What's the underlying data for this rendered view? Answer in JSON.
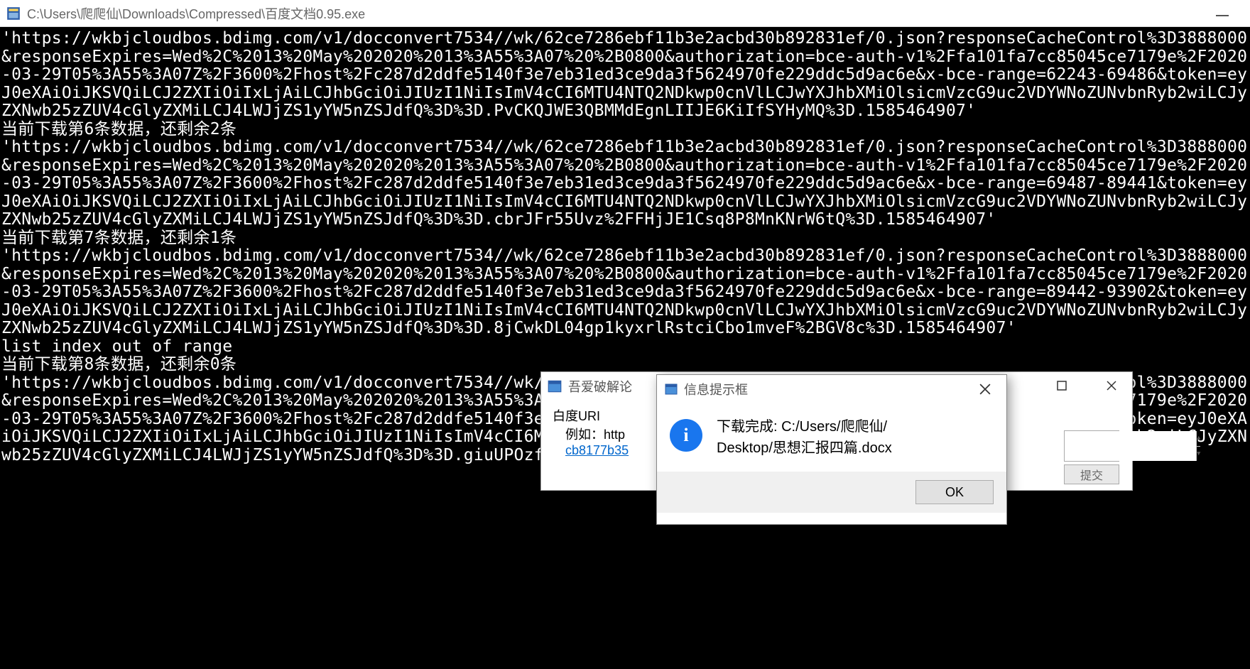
{
  "main_window": {
    "title": "C:\\Users\\爬爬仙\\Downloads\\Compressed\\百度文档0.95.exe"
  },
  "console_text": "'https://wkbjcloudbos.bdimg.com/v1/docconvert7534//wk/62ce7286ebf11b3e2acbd30b892831ef/0.json?responseCacheControl%3D3888000&responseExpires=Wed%2C%2013%20May%202020%2013%3A55%3A07%20%2B0800&authorization=bce-auth-v1%2Ffa101fa7cc85045ce7179e%2F2020-03-29T05%3A55%3A07Z%2F3600%2Fhost%2Fc287d2ddfe5140f3e7eb31ed3ce9da3f5624970fe229ddc5d9ac6e&x-bce-range=62243-69486&token=eyJ0eXAiOiJKSVQiLCJ2ZXIiOiIxLjAiLCJhbGciOiJIUzI1NiIsImV4cCI6MTU4NTQ2NDkwp0cnVlLCJwYXJhbXMiOlsicmVzcG9uc2VDYWNoZUNvbnRyb2wiLCJyZXNwb25zZUV4cGlyZXMiLCJ4LWJjZS1yYW5nZSJdfQ%3D%3D.PvCKQJWE3QBMMdEgnLIIJE6KiIfSYHyMQ%3D.1585464907'\n当前下载第6条数据，还剩余2条\n'https://wkbjcloudbos.bdimg.com/v1/docconvert7534//wk/62ce7286ebf11b3e2acbd30b892831ef/0.json?responseCacheControl%3D3888000&responseExpires=Wed%2C%2013%20May%202020%2013%3A55%3A07%20%2B0800&authorization=bce-auth-v1%2Ffa101fa7cc85045ce7179e%2F2020-03-29T05%3A55%3A07Z%2F3600%2Fhost%2Fc287d2ddfe5140f3e7eb31ed3ce9da3f5624970fe229ddc5d9ac6e&x-bce-range=69487-89441&token=eyJ0eXAiOiJKSVQiLCJ2ZXIiOiIxLjAiLCJhbGciOiJIUzI1NiIsImV4cCI6MTU4NTQ2NDkwp0cnVlLCJwYXJhbXMiOlsicmVzcG9uc2VDYWNoZUNvbnRyb2wiLCJyZXNwb25zZUV4cGlyZXMiLCJ4LWJjZS1yYW5nZSJdfQ%3D%3D.cbrJFr55Uvz%2FFHjJE1Csq8P8MnKNrW6tQ%3D.1585464907'\n当前下载第7条数据，还剩余1条\n'https://wkbjcloudbos.bdimg.com/v1/docconvert7534//wk/62ce7286ebf11b3e2acbd30b892831ef/0.json?responseCacheControl%3D3888000&responseExpires=Wed%2C%2013%20May%202020%2013%3A55%3A07%20%2B0800&authorization=bce-auth-v1%2Ffa101fa7cc85045ce7179e%2F2020-03-29T05%3A55%3A07Z%2F3600%2Fhost%2Fc287d2ddfe5140f3e7eb31ed3ce9da3f5624970fe229ddc5d9ac6e&x-bce-range=89442-93902&token=eyJ0eXAiOiJKSVQiLCJ2ZXIiOiIxLjAiLCJhbGciOiJIUzI1NiIsImV4cCI6MTU4NTQ2NDkwp0cnVlLCJwYXJhbXMiOlsicmVzcG9uc2VDYWNoZUNvbnRyb2wiLCJyZXNwb25zZUV4cGlyZXMiLCJ4LWJjZS1yYW5nZSJdfQ%3D%3D.8jCwkDL04gp1kyxrlRstciCbo1mveF%2BGV8c%3D.1585464907'\nlist index out of range\n当前下载第8条数据，还剩余0条\n'https://wkbjcloudbos.bdimg.com/v1/docconvert7534//wk/62ce7286ebf11b3e2acbd30b892831ef/0.json?responseCacheControl%3D3888000&responseExpires=Wed%2C%2013%20May%202020%2013%3A55%3A07%20%2B0800&authorization=bce-auth-v1%2Ffa101fa7cc85045ce7179e%2F2020-03-29T05%3A55%3A07Z%2F3600%2Fhost%2Fc287d2ddfe5140f3e7eb31ed3ce9da3f5624970fe229ddc5d9ac6e&x-bce-range=93903-&token=eyJ0eXAiOiJKSVQiLCJ2ZXIiOiIxLjAiLCJhbGciOiJIUzI1NiIsImV4cCI6MTU4NTQ2NDkwNywidXJlLCJwYXJhbXMiOlsicmVzcG9uc2VDYWNoZUNvbnRyb2wiLCJyZXNwb25zZUV4cGlyZXMiLCJ4LWJjZS1yYW5nZSJdfQ%3D%3D.giuUPOzfMIo",
  "dialog_back": {
    "title": "吾爱破解论",
    "label_uri": "白度URI",
    "example": "例如：http",
    "link": "cb8177b35",
    "submit": "提交"
  },
  "dialog_front": {
    "title": "信息提示框",
    "message_line1": "下载完成: C:/Users/爬爬仙/",
    "message_line2": "Desktop/思想汇报四篇.docx",
    "ok": "OK"
  }
}
